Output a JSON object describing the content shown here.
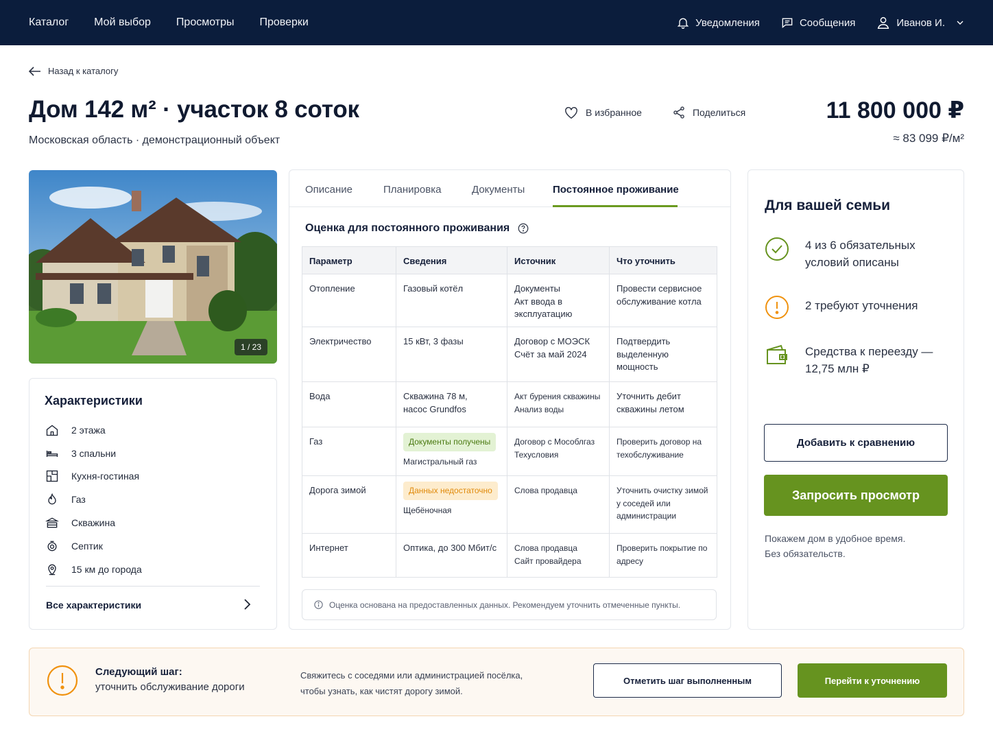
{
  "nav": {
    "items": [
      "Каталог",
      "Мой выбор",
      "Просмотры",
      "Проверки"
    ],
    "notifications": "Уведомления",
    "messages": "Сообщения",
    "user": "Иванов И."
  },
  "back": "Назад к каталогу",
  "listing": {
    "title": "Дом 142 м² · участок 8 соток",
    "subtitle": "Московская область · демонстрационный объект",
    "favorite": "В избранное",
    "share": "Поделиться",
    "price": "11 800 000 ₽",
    "price_per_m2": "≈ 83 099 ₽/м²",
    "photo_counter": "1 / 23"
  },
  "characteristics": {
    "title": "Характеристики",
    "items": [
      {
        "icon": "house-icon",
        "label": "2 этажа"
      },
      {
        "icon": "bed-icon",
        "label": "3 спальни"
      },
      {
        "icon": "floorplan-icon",
        "label": "Кухня-гостиная"
      },
      {
        "icon": "flame-icon",
        "label": "Газ"
      },
      {
        "icon": "well-icon",
        "label": "Скважина"
      },
      {
        "icon": "septic-icon",
        "label": "Септик"
      },
      {
        "icon": "location-pin-icon",
        "label": "15 км до города"
      }
    ],
    "all_link": "Все характеристики"
  },
  "tabs": [
    "Описание",
    "Планировка",
    "Документы",
    "Постоянное проживание"
  ],
  "active_tab": "Постоянное проживание",
  "assessment": {
    "title": "Оценка для постоянного проживания",
    "columns": [
      "Параметр",
      "Сведения",
      "Источник",
      "Что уточнить"
    ],
    "rows": [
      {
        "param": "Отопление",
        "badge": "",
        "badge_type": "",
        "info": "Газовый котёл",
        "source": "Документы\nАкт ввода в эксплуатацию",
        "todo": "Провести сервисное обслуживание котла"
      },
      {
        "param": "Электричество",
        "badge": "",
        "badge_type": "",
        "info": "15 кВт, 3 фазы",
        "source": "Договор с МОЭСК\nСчёт за май 2024",
        "todo": "Подтвердить выделенную мощность"
      },
      {
        "param": "Вода",
        "badge": "",
        "badge_type": "",
        "info": "Скважина 78 м,\nнасос Grundfos",
        "source": "Акт бурения скважины\nАнализ воды",
        "todo": "Уточнить дебит скважины летом"
      },
      {
        "param": "Газ",
        "badge": "Документы получены",
        "badge_type": "ok",
        "info": "Магистральный газ",
        "source": "Договор с Мособлгаз\nТехусловия",
        "todo": "Проверить договор на техобслуживание"
      },
      {
        "param": "Дорога зимой",
        "badge": "Данных недостаточно",
        "badge_type": "warn",
        "info": "Щебёночная",
        "source": "Слова продавца",
        "todo": "Уточнить очистку зимой у соседей или администрации"
      },
      {
        "param": "Интернет",
        "badge": "",
        "badge_type": "",
        "info": "Оптика, до 300 Мбит/с",
        "source": "Слова продавца\nСайт провайдера",
        "todo": "Проверить покрытие по адресу"
      }
    ],
    "note": "Оценка основана на предоставленных данных. Рекомендуем уточнить отмеченные пункты."
  },
  "family": {
    "title": "Для вашей семьи",
    "described": "4 из 6 обязательных условий описаны",
    "need_check": "2 требуют уточнения",
    "funds": "Средства к переезду — 12,75 млн ₽",
    "compare_button": "Добавить к сравнению",
    "request_button": "Запросить просмотр",
    "note": "Покажем дом в удобное время.\nБез обязательств."
  },
  "next_step": {
    "title": "Следующий шаг:",
    "subtitle": "уточнить обслуживание дороги",
    "description": "Свяжитесь с соседями или администрацией посёлка,\nчтобы узнать, как чистят дорогу зимой.",
    "done_button": "Отметить шаг выполненным",
    "go_button": "Перейти к уточнению"
  },
  "colors": {
    "nav_bg": "#0b1d3c",
    "accent_green": "#66931f",
    "warning": "#f0920f"
  }
}
